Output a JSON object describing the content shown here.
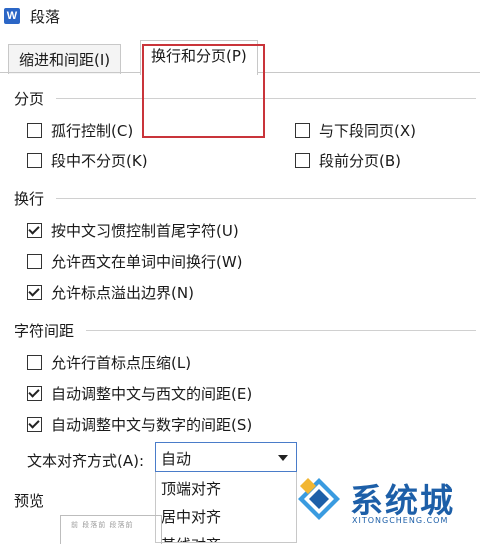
{
  "window": {
    "title": "段落",
    "app_icon": "W"
  },
  "tabs": [
    {
      "label": "缩进和间距(I)",
      "active": false
    },
    {
      "label": "换行和分页(P)",
      "active": true
    }
  ],
  "pagination": {
    "heading": "分页",
    "options": [
      {
        "label": "孤行控制(C)",
        "checked": false
      },
      {
        "label": "与下段同页(X)",
        "checked": false
      },
      {
        "label": "段中不分页(K)",
        "checked": false
      },
      {
        "label": "段前分页(B)",
        "checked": false
      }
    ]
  },
  "line_breaks": {
    "heading": "换行",
    "options": [
      {
        "label": "按中文习惯控制首尾字符(U)",
        "checked": true
      },
      {
        "label": "允许西文在单词中间换行(W)",
        "checked": false
      },
      {
        "label": "允许标点溢出边界(N)",
        "checked": true
      }
    ]
  },
  "char_spacing": {
    "heading": "字符间距",
    "options": [
      {
        "label": "允许行首标点压缩(L)",
        "checked": false
      },
      {
        "label": "自动调整中文与西文的间距(E)",
        "checked": true
      },
      {
        "label": "自动调整中文与数字的间距(S)",
        "checked": true
      }
    ]
  },
  "text_alignment": {
    "label": "文本对齐方式(A):",
    "selected": "自动",
    "options": [
      "顶端对齐",
      "居中对齐",
      "基线对齐"
    ]
  },
  "preview": {
    "heading": "预览",
    "sample_text": "前 段落前 段落前"
  },
  "watermark": {
    "text": "系统城",
    "subtext": "XITONGCHENG.COM"
  },
  "colors": {
    "highlight": "#c9343a",
    "accent": "#4a7cc9",
    "watermark": "#1d5fa8"
  }
}
